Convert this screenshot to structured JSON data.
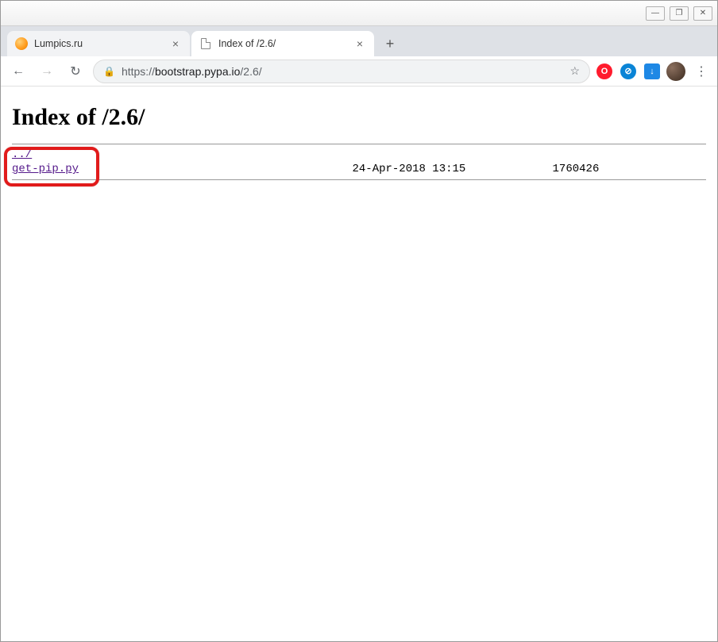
{
  "window_controls": {
    "min": "—",
    "max": "❐",
    "close": "✕"
  },
  "tabs": [
    {
      "title": "Lumpics.ru",
      "favicon": "orange"
    },
    {
      "title": "Index of /2.6/",
      "favicon": "page",
      "active": true
    }
  ],
  "newtab_label": "+",
  "toolbar": {
    "back_glyph": "←",
    "forward_glyph": "→",
    "reload_glyph": "↻",
    "lock_glyph": "🔒",
    "url_scheme": "https://",
    "url_host": "bootstrap.pypa.io",
    "url_path": "/2.6/",
    "star_glyph": "☆",
    "menu_glyph": "⋮"
  },
  "ext_icons": [
    {
      "name": "opera-icon",
      "bg": "#ff1b2d",
      "glyph": "O"
    },
    {
      "name": "adblock-icon",
      "bg": "#0a84d6",
      "glyph": "⊘"
    },
    {
      "name": "downloader-icon",
      "bg": "#1e88e5",
      "glyph": "↓"
    }
  ],
  "page": {
    "heading": "Index of /2.6/",
    "entries": [
      {
        "name": "../",
        "date": "",
        "size": ""
      },
      {
        "name": "get-pip.py",
        "date": "24-Apr-2018 13:15",
        "size": "1760426"
      }
    ]
  }
}
